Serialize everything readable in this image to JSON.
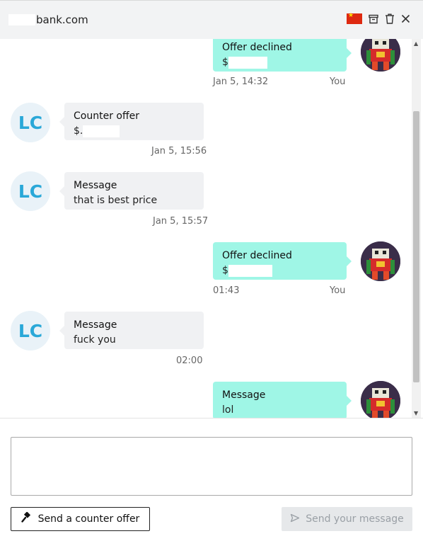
{
  "header": {
    "title": "bank.com",
    "icons": [
      "china-flag-icon",
      "archive-icon",
      "trash-icon",
      "close-icon"
    ]
  },
  "messages": [
    {
      "direction": "out",
      "title": "Offer declined",
      "body": "$",
      "time": "Jan 5, 14:32",
      "sender": "You"
    },
    {
      "direction": "in",
      "avatar": "LC",
      "title": "Counter offer",
      "body": "$.",
      "time": "Jan 5, 15:56",
      "sender": ""
    },
    {
      "direction": "in",
      "avatar": "LC",
      "title": "Message",
      "body": "that is best price",
      "time": "Jan 5, 15:57",
      "sender": ""
    },
    {
      "direction": "out",
      "title": "Offer declined",
      "body": "$",
      "time": "01:43",
      "sender": "You"
    },
    {
      "direction": "in",
      "avatar": "LC",
      "title": "Message",
      "body": "fuck you",
      "time": "02:00",
      "sender": ""
    },
    {
      "direction": "out",
      "title": "Message",
      "body": "lol",
      "time": "",
      "sender": ""
    }
  ],
  "composer": {
    "placeholder": "",
    "counter_offer_label": "Send a counter offer",
    "send_label": "Send your message"
  },
  "colors": {
    "outgoing_bubble": "#9ff6e6",
    "incoming_bubble": "#f0f1f3",
    "avatar_text": "#2aa8d8",
    "header_bg": "#f2f3f4"
  }
}
